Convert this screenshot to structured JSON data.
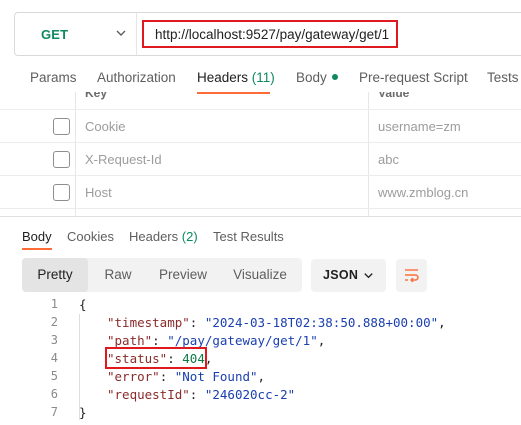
{
  "request": {
    "method": "GET",
    "url": "http://localhost:9527/pay/gateway/get/1"
  },
  "request_tabs": [
    {
      "label": "Params"
    },
    {
      "label": "Authorization"
    },
    {
      "label": "Headers",
      "count": "(11)",
      "active": true
    },
    {
      "label": "Body",
      "has_dot": true
    },
    {
      "label": "Pre-request Script"
    },
    {
      "label": "Tests"
    }
  ],
  "headers_table": {
    "columns": [
      "Key",
      "Value"
    ],
    "rows": [
      {
        "key": "Cookie",
        "value": "username=zm",
        "checked": false
      },
      {
        "key": "X-Request-Id",
        "value": "abc",
        "checked": false
      },
      {
        "key": "Host",
        "value": "www.zmblog.cn",
        "checked": false
      }
    ]
  },
  "response_tabs": [
    {
      "label": "Body",
      "active": true
    },
    {
      "label": "Cookies"
    },
    {
      "label": "Headers",
      "count": "(2)"
    },
    {
      "label": "Test Results"
    }
  ],
  "view_modes": [
    "Pretty",
    "Raw",
    "Preview",
    "Visualize"
  ],
  "active_view_mode": "Pretty",
  "format": "JSON",
  "code": {
    "line_numbers": [
      "1",
      "2",
      "3",
      "4",
      "5",
      "6",
      "7"
    ],
    "open_brace": "{",
    "close_brace": "}",
    "entries": [
      {
        "key": "\"timestamp\"",
        "value": "\"2024-03-18T02:38:50.888+00:00\"",
        "type": "string",
        "comma": ","
      },
      {
        "key": "\"path\"",
        "value": "\"/pay/gateway/get/1\"",
        "type": "string",
        "comma": ","
      },
      {
        "key": "\"status\"",
        "value": "404",
        "type": "number",
        "comma": ","
      },
      {
        "key": "\"error\"",
        "value": "\"Not Found\"",
        "type": "string",
        "comma": ","
      },
      {
        "key": "\"requestId\"",
        "value": "\"246020cc-2\"",
        "type": "string",
        "comma": ""
      }
    ]
  },
  "colors": {
    "accent": "#ff6c37",
    "method_green": "#0f8a5f",
    "highlight_red": "#e0191f"
  }
}
